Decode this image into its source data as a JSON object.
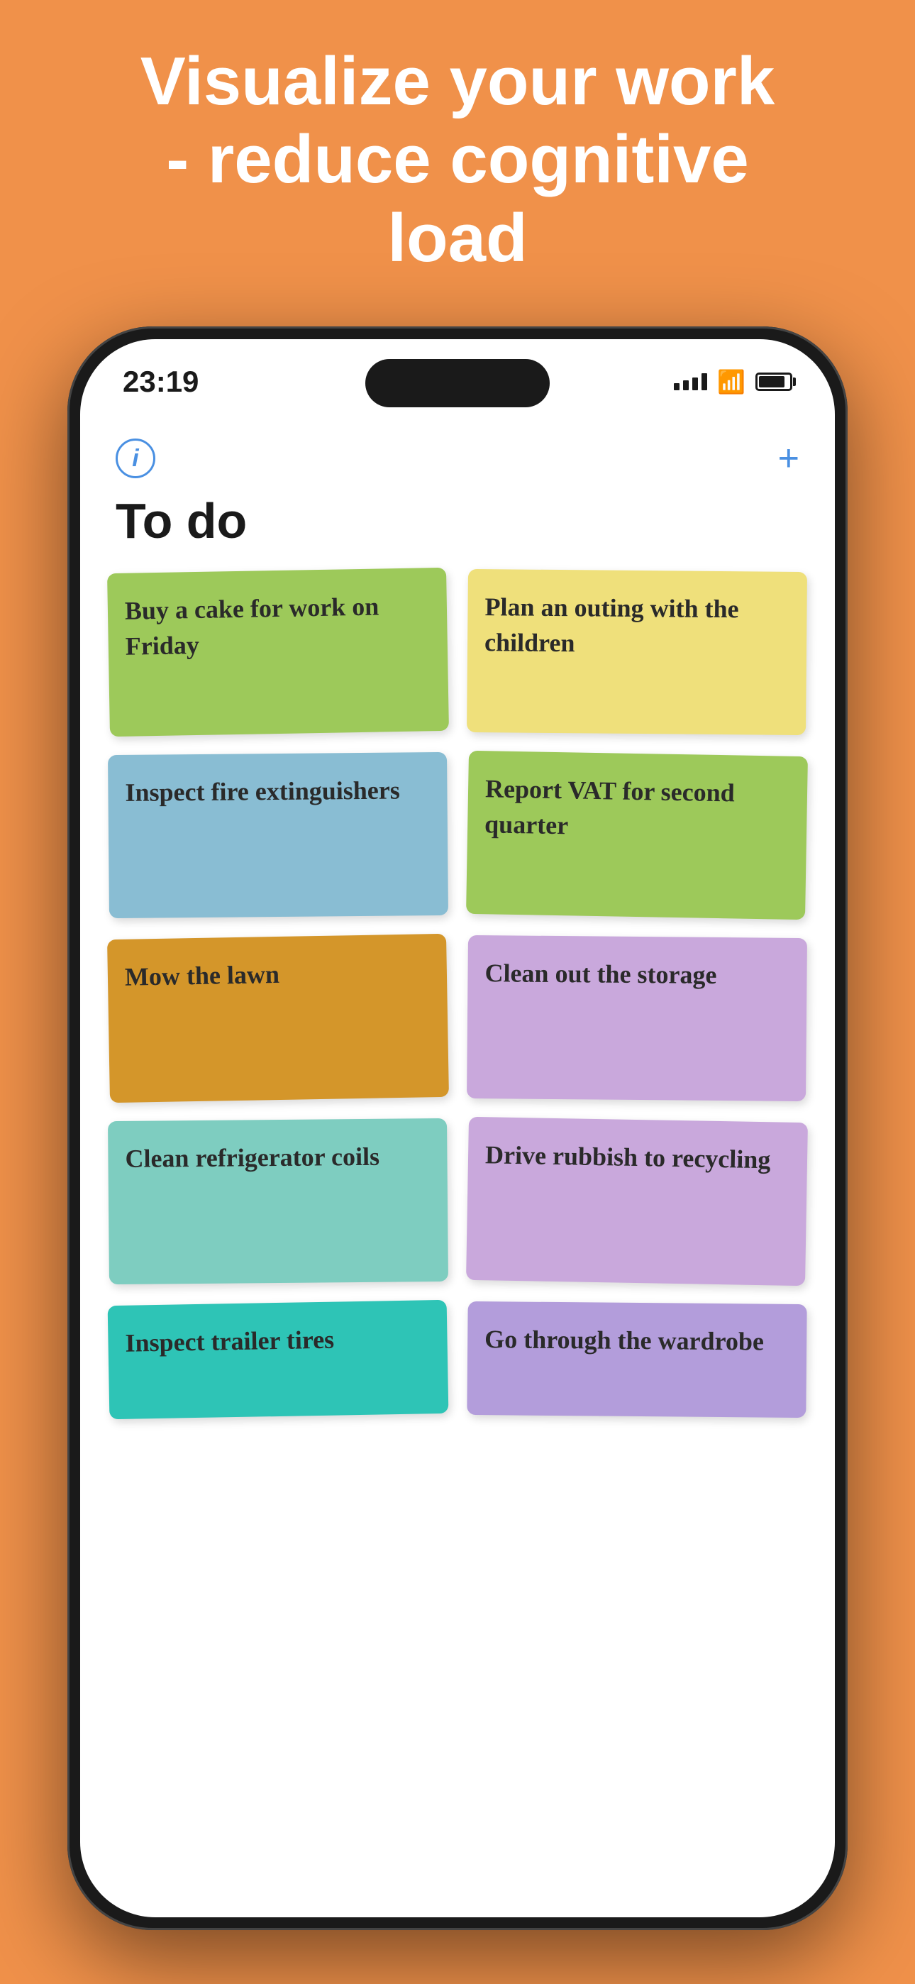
{
  "hero": {
    "line1": "Visualize your work",
    "line2": "- reduce cognitive",
    "line3": "load"
  },
  "status_bar": {
    "time": "23:19",
    "signal_label": "signal",
    "wifi_label": "wifi",
    "battery_label": "battery"
  },
  "toolbar": {
    "info_label": "i",
    "add_label": "+"
  },
  "app": {
    "title": "To do"
  },
  "cards": [
    {
      "id": 1,
      "text": "Buy a cake for work on Friday",
      "color_class": "card-green-light",
      "tilt": "card-tilt-1",
      "col": "left"
    },
    {
      "id": 2,
      "text": "Plan an outing with the children",
      "color_class": "card-yellow",
      "tilt": "card-tilt-2",
      "col": "right"
    },
    {
      "id": 3,
      "text": "Inspect fire extinguishers",
      "color_class": "card-blue-light",
      "tilt": "card-tilt-3",
      "col": "left"
    },
    {
      "id": 4,
      "text": "Report VAT for second quarter",
      "color_class": "card-green-bright",
      "tilt": "card-tilt-4",
      "col": "right"
    },
    {
      "id": 5,
      "text": "Mow the lawn",
      "color_class": "card-orange",
      "tilt": "card-tilt-1",
      "col": "left"
    },
    {
      "id": 6,
      "text": "Clean out the storage",
      "color_class": "card-purple-light",
      "tilt": "card-tilt-2",
      "col": "right"
    },
    {
      "id": 7,
      "text": "Clean refrigerator coils",
      "color_class": "card-teal-light",
      "tilt": "card-tilt-3",
      "col": "left"
    },
    {
      "id": 8,
      "text": "Drive rubbish to recycling",
      "color_class": "card-pink-purple",
      "tilt": "card-tilt-4",
      "col": "right"
    },
    {
      "id": 9,
      "text": "Inspect trailer tires",
      "color_class": "card-teal-bottom",
      "tilt": "card-tilt-1",
      "col": "left"
    },
    {
      "id": 10,
      "text": "Go through the wardrobe",
      "color_class": "card-purple-bottom",
      "tilt": "card-tilt-2",
      "col": "right"
    }
  ]
}
